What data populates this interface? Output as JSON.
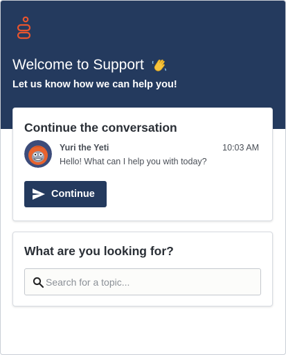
{
  "header": {
    "logo_icon": "brand-logo-icon",
    "title": "Welcome to Support",
    "title_emoji_icon": "waving-hand-icon",
    "subtitle": "Let us know how we can help you!",
    "background_color": "#243a5e",
    "accent_color": "#e8552e"
  },
  "conversation_card": {
    "heading": "Continue the conversation",
    "message": {
      "sender": "Yuri the Yeti",
      "time": "10:03 AM",
      "preview": "Hello! What can I help you with today?",
      "avatar_icon": "yeti-avatar-icon"
    },
    "continue_button": {
      "label": "Continue",
      "icon": "send-icon"
    }
  },
  "search_card": {
    "heading": "What are you looking for?",
    "search": {
      "placeholder": "Search for a topic...",
      "value": "",
      "icon": "search-icon"
    }
  }
}
